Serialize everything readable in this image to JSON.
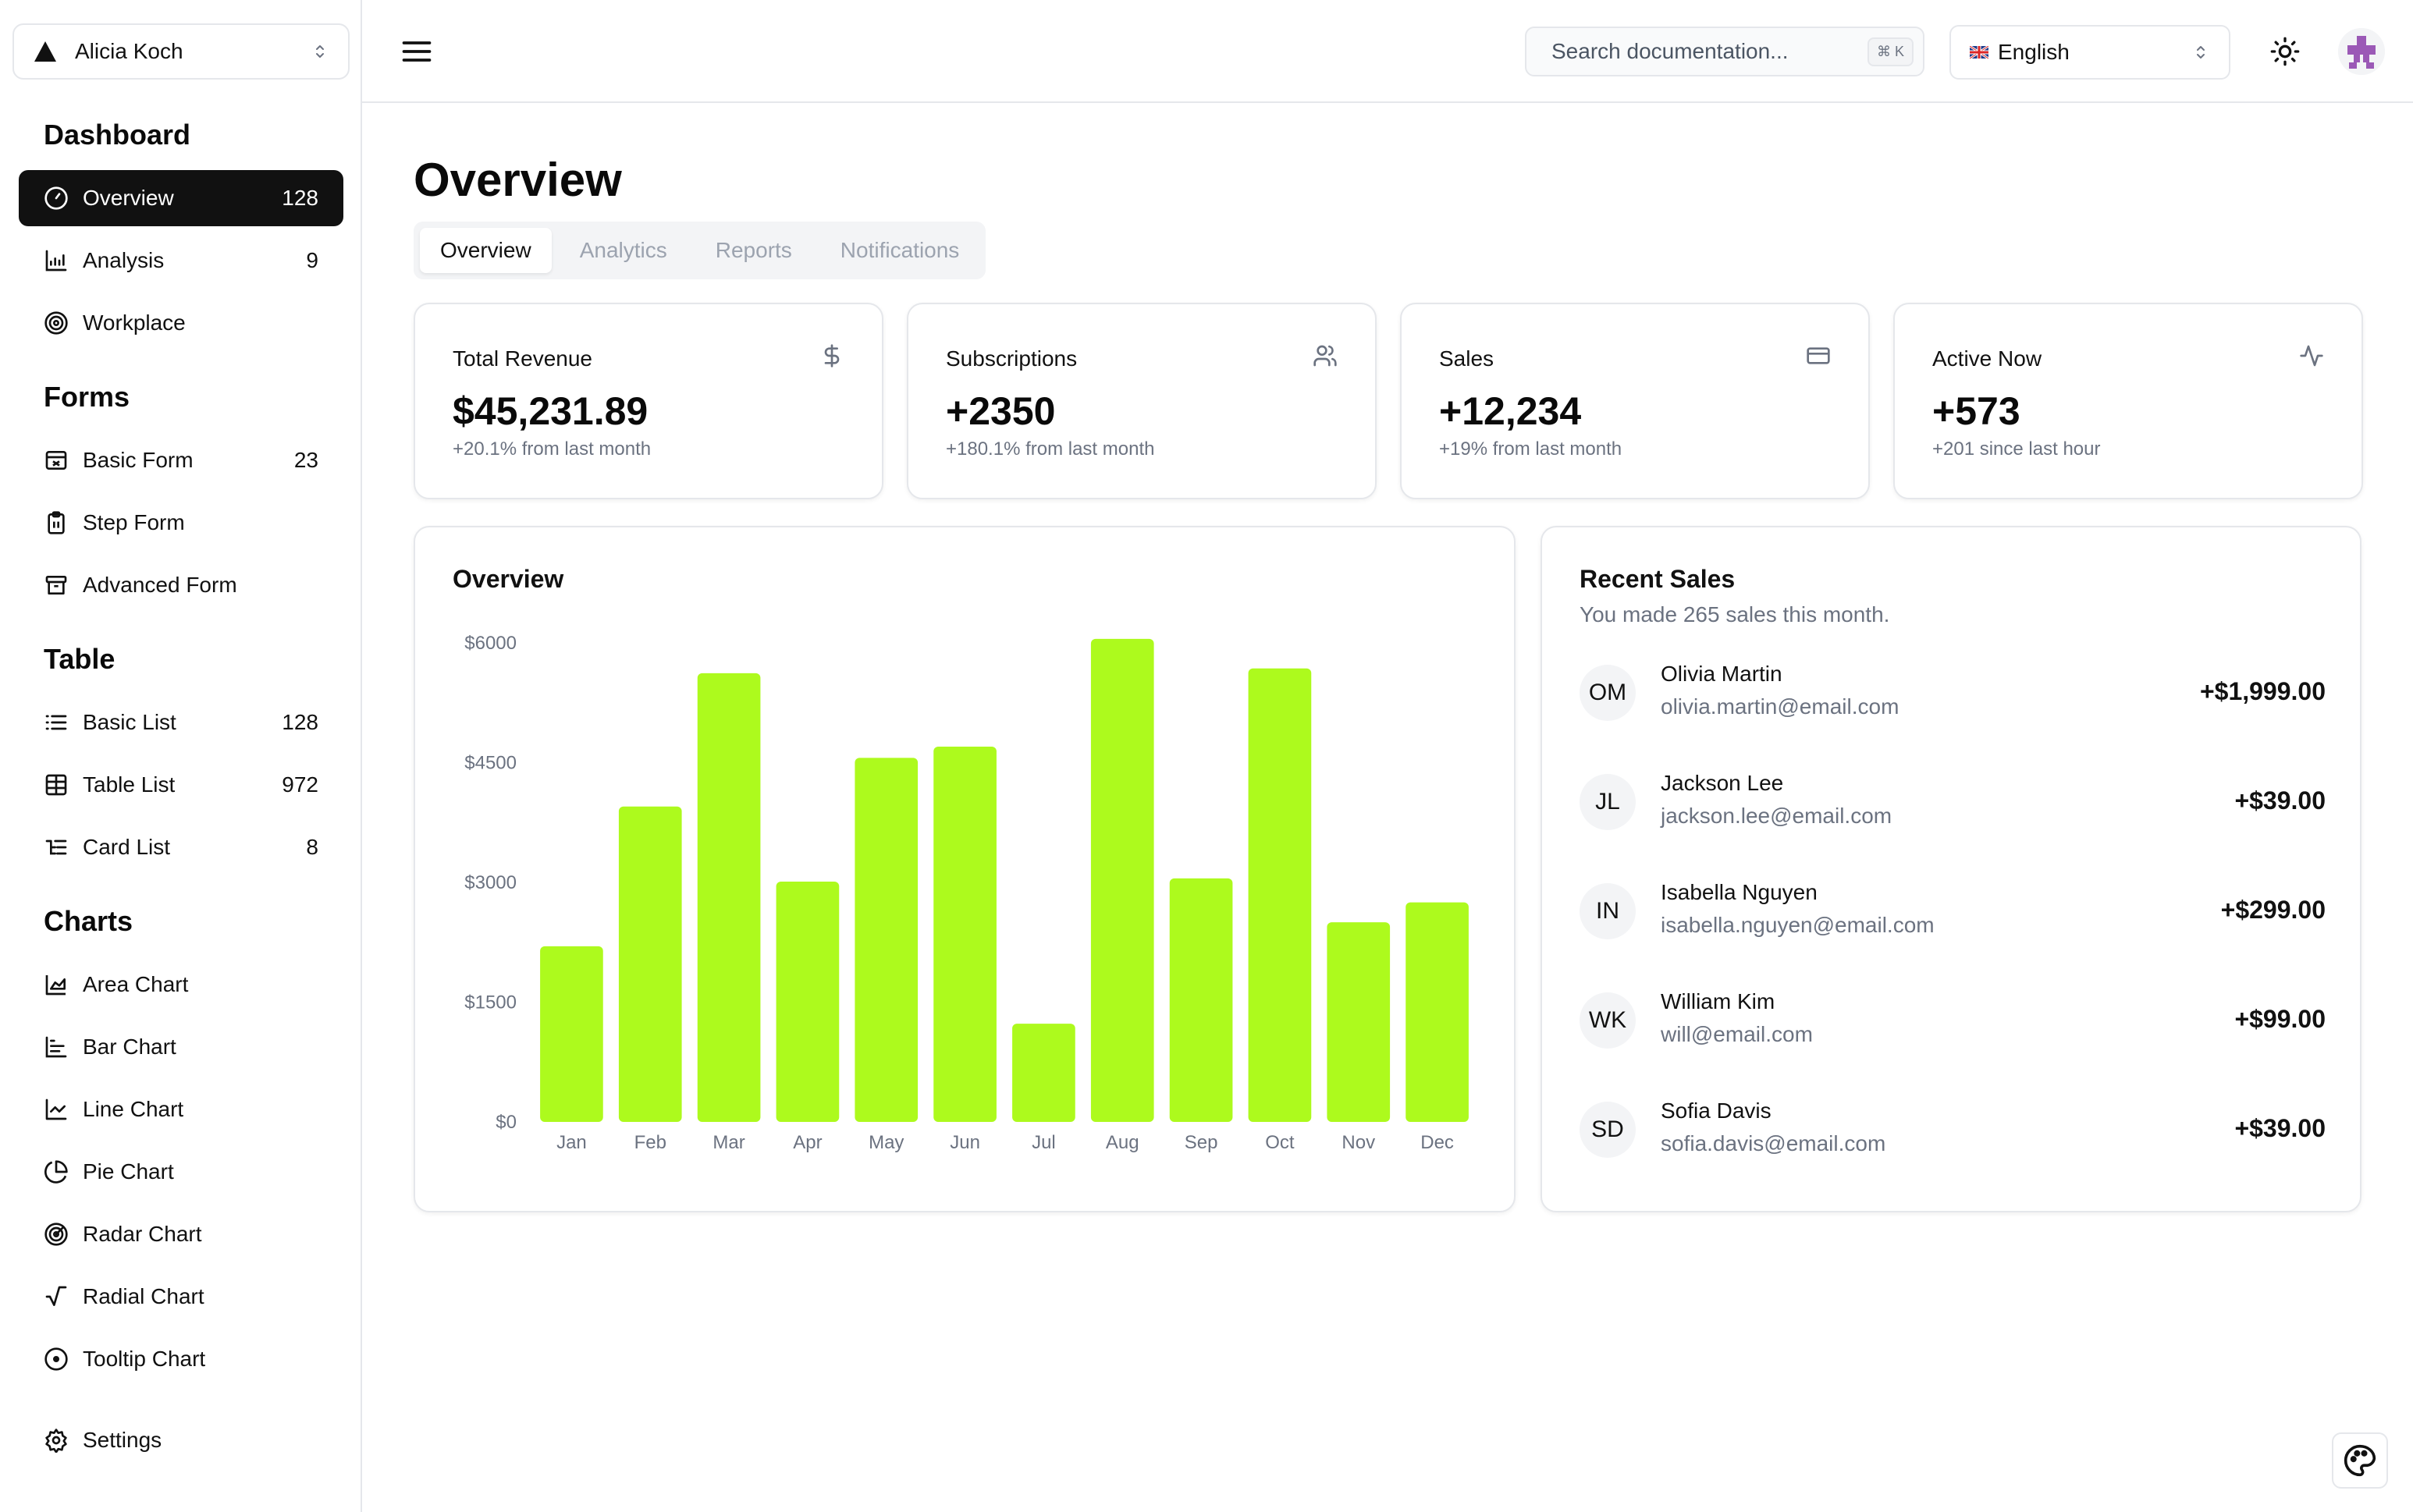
{
  "sidebar": {
    "team_name": "Alicia Koch",
    "groups": [
      {
        "title": "Dashboard"
      },
      {
        "title": "Forms"
      },
      {
        "title": "Table"
      },
      {
        "title": "Charts"
      }
    ],
    "items": [
      {
        "label": "Overview",
        "count": "128",
        "icon": "gauge-icon"
      },
      {
        "label": "Analysis",
        "count": "9",
        "icon": "bar-chart-icon"
      },
      {
        "label": "Workplace",
        "count": "",
        "icon": "target-icon"
      },
      {
        "label": "Basic Form",
        "count": "23",
        "icon": "form-icon"
      },
      {
        "label": "Step Form",
        "count": "",
        "icon": "clipboard-icon"
      },
      {
        "label": "Advanced Form",
        "count": "",
        "icon": "archive-icon"
      },
      {
        "label": "Basic List",
        "count": "128",
        "icon": "list-icon"
      },
      {
        "label": "Table List",
        "count": "972",
        "icon": "table-icon"
      },
      {
        "label": "Card List",
        "count": "8",
        "icon": "list-tree-icon"
      },
      {
        "label": "Area Chart",
        "count": "",
        "icon": "area-chart-icon"
      },
      {
        "label": "Bar Chart",
        "count": "",
        "icon": "bar-chart-horizontal-icon"
      },
      {
        "label": "Line Chart",
        "count": "",
        "icon": "line-chart-icon"
      },
      {
        "label": "Pie Chart",
        "count": "",
        "icon": "pie-chart-icon"
      },
      {
        "label": "Radar Chart",
        "count": "",
        "icon": "radar-icon"
      },
      {
        "label": "Radial Chart",
        "count": "",
        "icon": "radical-icon"
      },
      {
        "label": "Tooltip Chart",
        "count": "",
        "icon": "circle-dot-icon"
      },
      {
        "label": "Settings",
        "count": "",
        "icon": "gear-icon"
      }
    ]
  },
  "header": {
    "search_placeholder": "Search documentation...",
    "search_shortcut": "⌘ K",
    "language": "English"
  },
  "main": {
    "title": "Overview",
    "tabs": [
      {
        "label": "Overview",
        "active": true
      },
      {
        "label": "Analytics",
        "active": false
      },
      {
        "label": "Reports",
        "active": false
      },
      {
        "label": "Notifications",
        "active": false
      }
    ],
    "stats": [
      {
        "title": "Total Revenue",
        "value": "$45,231.89",
        "sub": "+20.1% from last month",
        "icon": "dollar-icon"
      },
      {
        "title": "Subscriptions",
        "value": "+2350",
        "sub": "+180.1% from last month",
        "icon": "users-icon"
      },
      {
        "title": "Sales",
        "value": "+12,234",
        "sub": "+19% from last month",
        "icon": "credit-card-icon"
      },
      {
        "title": "Active Now",
        "value": "+573",
        "sub": "+201 since last hour",
        "icon": "activity-icon"
      }
    ],
    "overview_title": "Overview",
    "recent_sales": {
      "title": "Recent Sales",
      "subtitle": "You made 265 sales this month.",
      "rows": [
        {
          "initials": "OM",
          "name": "Olivia Martin",
          "email": "olivia.martin@email.com",
          "amount": "+$1,999.00"
        },
        {
          "initials": "JL",
          "name": "Jackson Lee",
          "email": "jackson.lee@email.com",
          "amount": "+$39.00"
        },
        {
          "initials": "IN",
          "name": "Isabella Nguyen",
          "email": "isabella.nguyen@email.com",
          "amount": "+$299.00"
        },
        {
          "initials": "WK",
          "name": "William Kim",
          "email": "will@email.com",
          "amount": "+$99.00"
        },
        {
          "initials": "SD",
          "name": "Sofia Davis",
          "email": "sofia.davis@email.com",
          "amount": "+$39.00"
        }
      ]
    }
  },
  "colors": {
    "bar": "#adfa1d",
    "active_nav": "#111111",
    "border": "#e5e7eb"
  },
  "chart_data": {
    "type": "bar",
    "title": "Overview",
    "categories": [
      "Jan",
      "Feb",
      "Mar",
      "Apr",
      "May",
      "Jun",
      "Jul",
      "Aug",
      "Sep",
      "Oct",
      "Nov",
      "Dec"
    ],
    "values": [
      2200,
      3950,
      5620,
      3010,
      4560,
      4700,
      1230,
      6050,
      3050,
      5680,
      2500,
      2750
    ],
    "y_ticks": [
      "$0",
      "$1500",
      "$3000",
      "$4500",
      "$6000"
    ],
    "y_tick_values": [
      0,
      1500,
      3000,
      4500,
      6000
    ],
    "ylim": [
      0,
      6000
    ],
    "grid": false,
    "legend": "none"
  }
}
